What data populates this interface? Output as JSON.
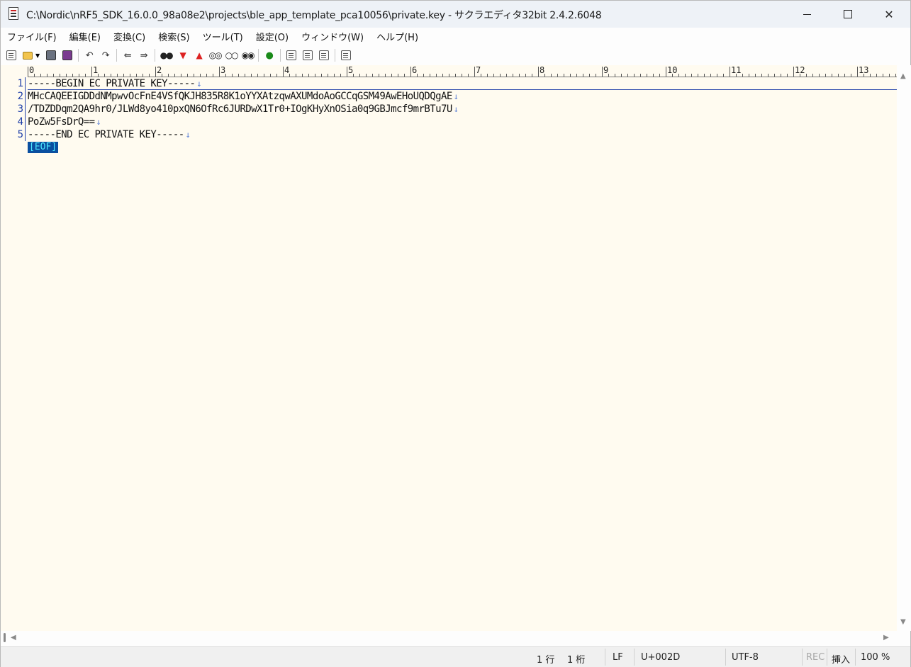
{
  "window": {
    "title": "C:\\Nordic\\nRF5_SDK_16.0.0_98a08e2\\projects\\ble_app_template_pca10056\\private.key - サクラエディタ32bit 2.4.2.6048",
    "icon": "sakura-editor-icon",
    "controls": {
      "minimize": "minimize-icon",
      "maximize": "maximize-icon",
      "close": "close-icon"
    }
  },
  "menu": {
    "items": [
      {
        "label": "ファイル(F)"
      },
      {
        "label": "編集(E)"
      },
      {
        "label": "変換(C)"
      },
      {
        "label": "検索(S)"
      },
      {
        "label": "ツール(T)"
      },
      {
        "label": "設定(O)"
      },
      {
        "label": "ウィンドウ(W)"
      },
      {
        "label": "ヘルプ(H)"
      }
    ]
  },
  "toolbar": {
    "icons": [
      "new-file-icon",
      "open-file-icon",
      "open-dropdown-icon",
      "save-icon",
      "save-all-icon",
      "undo-icon",
      "redo-icon",
      "jump-back-icon",
      "jump-forward-icon",
      "search-icon",
      "search-next-icon",
      "search-prev-icon",
      "replace-icon",
      "search-clear-icon",
      "grep-icon",
      "outline-icon",
      "compare-icon",
      "compare-next-icon",
      "compare-tool-icon",
      "tag-jump-icon"
    ]
  },
  "ruler": {
    "labels": [
      "0",
      "1",
      "2",
      "3",
      "4",
      "5",
      "6",
      "7",
      "8",
      "9",
      "10",
      "11",
      "12",
      "13"
    ]
  },
  "editor": {
    "lines": [
      {
        "number": "1",
        "text": "-----BEGIN EC PRIVATE KEY-----",
        "eol": "↓"
      },
      {
        "number": "2",
        "text": "MHcCAQEEIGDDdNMpwvOcFnE4VSfQKJH835R8K1oYYXAtzqwAXUMdoAoGCCqGSM49AwEHoUQDQgAE",
        "eol": "↓"
      },
      {
        "number": "3",
        "text": "/TDZDDqm2QA9hr0/JLWd8yo410pxQN6OfRc6JURDwX1Tr0+IOgKHyXnOSia0q9GBJmcf9mrBTu7U",
        "eol": "↓"
      },
      {
        "number": "4",
        "text": "PoZw5FsDrQ==",
        "eol": "↓"
      },
      {
        "number": "5",
        "text": "-----END EC PRIVATE KEY-----",
        "eol": "↓"
      }
    ],
    "eof_marker": "[EOF]"
  },
  "statusbar": {
    "row": "1 行",
    "col": "1 桁",
    "eol_type": "LF",
    "char_code": "U+002D",
    "encoding": "UTF-8",
    "rec": "REC",
    "insert_mode": "挿入",
    "zoom": "100 %"
  },
  "colors": {
    "editor_bg": "#fffbf0",
    "line_number": "#1f3fa8",
    "eof_bg": "#0a4fa0",
    "eof_fg": "#4de8ff"
  }
}
